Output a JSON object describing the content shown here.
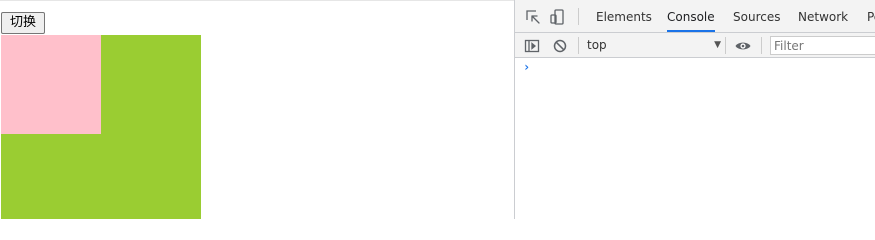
{
  "page": {
    "toggle_button_label": "切换",
    "colors": {
      "green_box": "#9acd32",
      "pink_box": "#ffc0cb"
    }
  },
  "devtools": {
    "tabs": [
      {
        "label": "Elements",
        "active": false
      },
      {
        "label": "Console",
        "active": true
      },
      {
        "label": "Sources",
        "active": false
      },
      {
        "label": "Network",
        "active": false
      },
      {
        "label": "Pe",
        "active": false
      }
    ],
    "icons": {
      "inspect": "inspect-element-icon",
      "device": "device-toolbar-icon",
      "sidebar": "show-sidebar-icon",
      "clear": "clear-console-icon",
      "eye": "live-expression-eye-icon",
      "prompt": "console-prompt-chevron-icon"
    },
    "context_select_value": "top",
    "filter_placeholder": "Filter",
    "accent_color": "#1a73e8"
  }
}
